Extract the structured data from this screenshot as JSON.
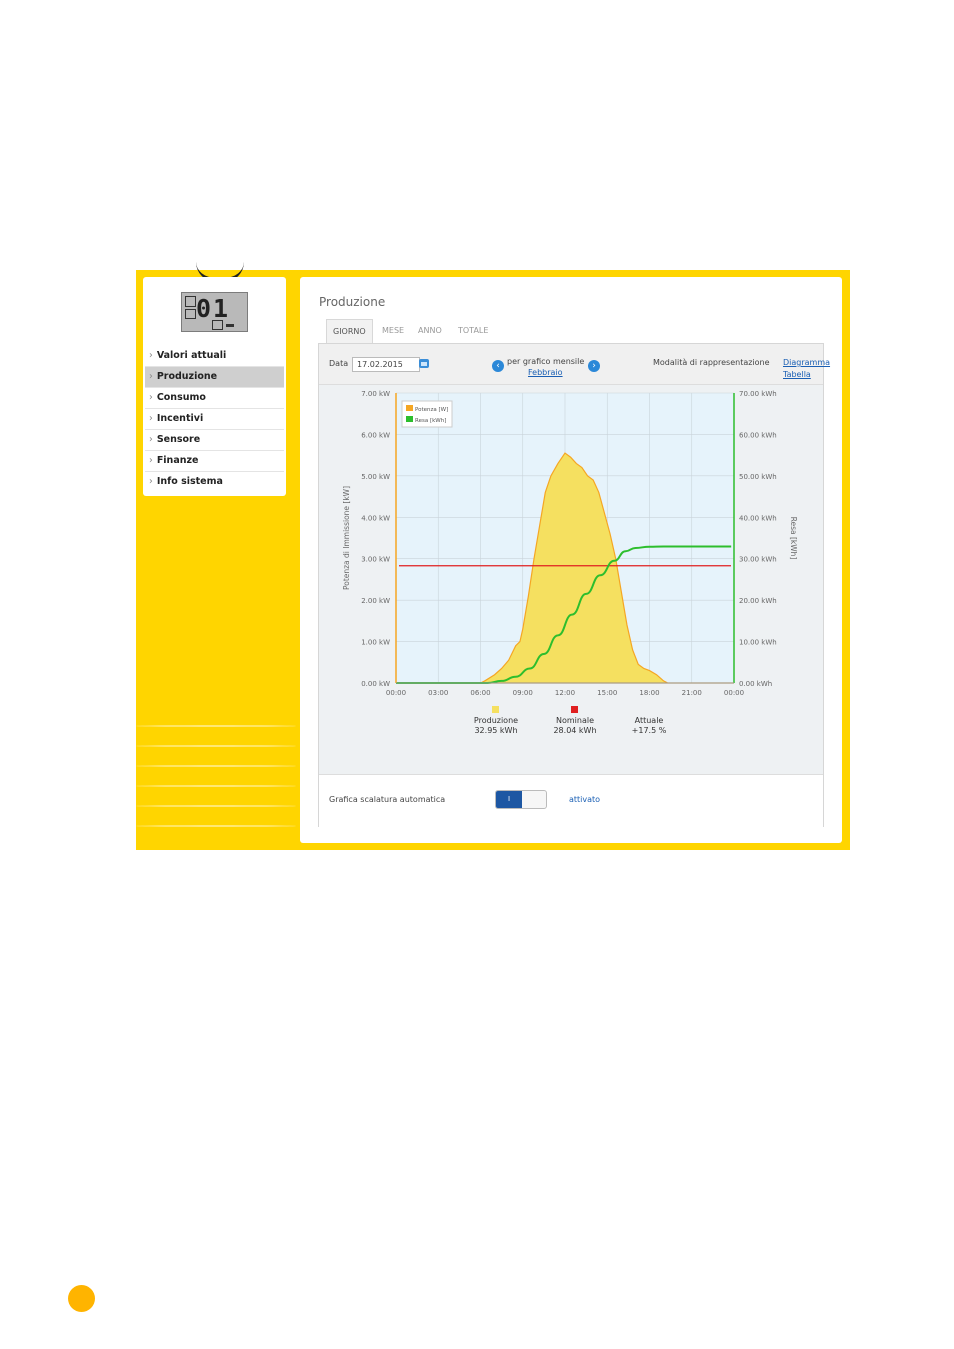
{
  "sidebar": {
    "lcd_digits": "01",
    "items": [
      {
        "label": "Valori attuali"
      },
      {
        "label": "Produzione"
      },
      {
        "label": "Consumo"
      },
      {
        "label": "Incentivi"
      },
      {
        "label": "Sensore"
      },
      {
        "label": "Finanze"
      },
      {
        "label": "Info sistema"
      }
    ],
    "active_index": 1
  },
  "main": {
    "title": "Produzione",
    "tabs": [
      {
        "label": "GIORNO"
      },
      {
        "label": "MESE"
      },
      {
        "label": "ANNO"
      },
      {
        "label": "TOTALE"
      }
    ],
    "active_tab": 0
  },
  "toolbar": {
    "date_label": "Data",
    "date_value": "17.02.2015",
    "per_grafico_label": "per grafico mensile",
    "month_link": "Febbraio",
    "mode_label": "Modalità di rappresentazione",
    "diagram_link": "Diagramma",
    "table_link": "Tabella"
  },
  "chart_data": {
    "type": "area",
    "ylabel": "Potenza di Immissione [kW]",
    "y2label": "Resa [kWh]",
    "x_ticks": [
      "00:00",
      "03:00",
      "06:00",
      "09:00",
      "12:00",
      "15:00",
      "18:00",
      "21:00",
      "00:00"
    ],
    "y_ticks": [
      "0.00 kW",
      "1.00 kW",
      "2.00 kW",
      "3.00 kW",
      "4.00 kW",
      "5.00 kW",
      "6.00 kW",
      "7.00 kW"
    ],
    "y2_ticks": [
      "0.00 kWh",
      "10.00 kWh",
      "20.00 kWh",
      "30.00 kWh",
      "40.00 kWh",
      "50.00 kWh",
      "60.00 kWh",
      "70.00 kWh"
    ],
    "ylim": [
      0,
      7
    ],
    "y2lim": [
      0,
      70
    ],
    "xlim": [
      0,
      24
    ],
    "grid": true,
    "legend_position": "top-left",
    "series": [
      {
        "name": "Potenza [W]",
        "axis": "left",
        "color": "#F5A623",
        "fill": "#F5E060",
        "points": [
          [
            0,
            0
          ],
          [
            6.0,
            0
          ],
          [
            6.3,
            0.05
          ],
          [
            7.0,
            0.2
          ],
          [
            7.5,
            0.35
          ],
          [
            8.0,
            0.55
          ],
          [
            8.5,
            0.9
          ],
          [
            8.8,
            1.0
          ],
          [
            9.0,
            1.3
          ],
          [
            9.4,
            2.1
          ],
          [
            9.8,
            3.0
          ],
          [
            10.2,
            3.8
          ],
          [
            10.6,
            4.6
          ],
          [
            11.0,
            5.0
          ],
          [
            11.5,
            5.3
          ],
          [
            12.0,
            5.55
          ],
          [
            12.4,
            5.45
          ],
          [
            12.8,
            5.3
          ],
          [
            13.2,
            5.2
          ],
          [
            13.6,
            5.0
          ],
          [
            14.0,
            4.9
          ],
          [
            14.4,
            4.6
          ],
          [
            14.8,
            4.1
          ],
          [
            15.2,
            3.6
          ],
          [
            15.6,
            3.0
          ],
          [
            16.0,
            2.2
          ],
          [
            16.4,
            1.4
          ],
          [
            16.8,
            0.8
          ],
          [
            17.2,
            0.45
          ],
          [
            17.6,
            0.35
          ],
          [
            18.0,
            0.3
          ],
          [
            18.5,
            0.2
          ],
          [
            19.0,
            0.05
          ],
          [
            19.3,
            0
          ],
          [
            24,
            0
          ]
        ]
      },
      {
        "name": "Resa [kWh]",
        "axis": "right",
        "color": "#2DBE2D",
        "points": [
          [
            0,
            0
          ],
          [
            6.5,
            0
          ],
          [
            7.5,
            0.5
          ],
          [
            8.5,
            1.5
          ],
          [
            9.5,
            3.5
          ],
          [
            10.5,
            7.0
          ],
          [
            11.5,
            11.5
          ],
          [
            12.5,
            16.5
          ],
          [
            13.5,
            21.5
          ],
          [
            14.5,
            26.0
          ],
          [
            15.5,
            29.5
          ],
          [
            16.3,
            31.8
          ],
          [
            17.0,
            32.6
          ],
          [
            18.0,
            32.9
          ],
          [
            19.0,
            32.95
          ],
          [
            23.8,
            32.95
          ]
        ]
      },
      {
        "name": "Nominale",
        "axis": "left",
        "color": "#E02020",
        "points": [
          [
            0,
            2.83
          ],
          [
            24,
            2.83
          ]
        ]
      }
    ],
    "summary": [
      {
        "label": "Produzione",
        "value": "32.95 kWh",
        "color": "#F5E060"
      },
      {
        "label": "Nominale",
        "value": "28.04 kWh",
        "color": "#E02020"
      },
      {
        "label": "Attuale",
        "value": "+17.5 %",
        "color": ""
      }
    ]
  },
  "autoscale": {
    "label": "Grafica scalatura automatica",
    "toggle_text": "I",
    "status": "attivato"
  }
}
